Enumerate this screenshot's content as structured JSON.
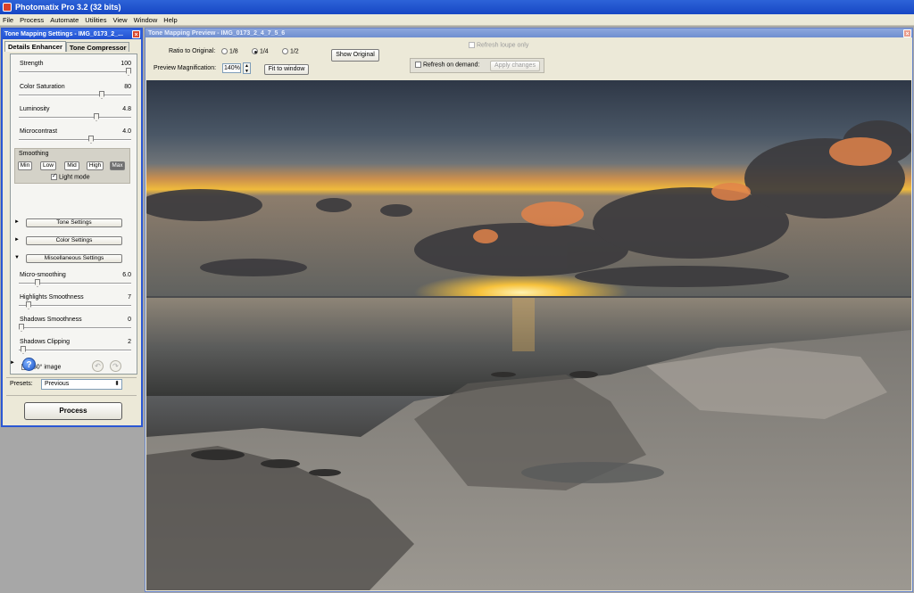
{
  "app": {
    "title": "Photomatix Pro 3.2 (32 bits)"
  },
  "menu": [
    "File",
    "Process",
    "Automate",
    "Utilities",
    "View",
    "Window",
    "Help"
  ],
  "settings_panel": {
    "title": "Tone Mapping Settings - IMG_0173_2_...",
    "close": "×",
    "tabs": [
      "Details Enhancer",
      "Tone Compressor"
    ],
    "active_tab": "Details Enhancer",
    "sliders": [
      {
        "label": "Strength",
        "value": "100",
        "position": 1.0
      },
      {
        "label": "Color Saturation",
        "value": "80",
        "position": 0.75
      },
      {
        "label": "Luminosity",
        "value": "4.8",
        "position": 0.7
      },
      {
        "label": "Microcontrast",
        "value": "4.0",
        "position": 0.65
      }
    ],
    "smoothing": {
      "title": "Smoothing",
      "buttons": [
        "Min",
        "Low",
        "Mid",
        "High",
        "Max"
      ],
      "selected": "Max",
      "light_mode_label": "Light mode",
      "light_mode_checked": true
    },
    "sections": [
      {
        "label": "Tone Settings",
        "expanded": false,
        "arrow": "►"
      },
      {
        "label": "Color Settings",
        "expanded": false,
        "arrow": "►"
      },
      {
        "label": "Miscellaneous Settings",
        "expanded": true,
        "arrow": "▼"
      }
    ],
    "misc_sliders": [
      {
        "label": "Micro-smoothing",
        "value": "6.0",
        "position": 0.15
      },
      {
        "label": "Highlights Smoothness",
        "value": "7",
        "position": 0.07
      },
      {
        "label": "Shadows Smoothness",
        "value": "0",
        "position": 0.0
      },
      {
        "label": "Shadows Clipping",
        "value": "2",
        "position": 0.02
      }
    ],
    "image_360_label": "360° image",
    "image_360_checked": false,
    "help_icon": "?",
    "undo_icon": "↶",
    "redo_icon": "↷",
    "expand_arrow": "►",
    "presets_label": "Presets:",
    "presets_value": "Previous",
    "select_caret": "⬍",
    "process_label": "Process"
  },
  "preview": {
    "title": "Tone Mapping Preview - IMG_0173_2_4_7_5_6",
    "close": "×",
    "ratio_label": "Ratio to Original:",
    "ratios": [
      "1/8",
      "1/4",
      "1/2"
    ],
    "ratio_selected": "1/4",
    "show_original_label": "Show Original",
    "magnification_label": "Preview Magnification:",
    "magnification_value": "140%",
    "spinner_up": "▲",
    "spinner_down": "▼",
    "fit_window_label": "Fit to window",
    "refresh_loupe_label": "Refresh loupe only",
    "refresh_demand_label": "Refresh on demand:",
    "apply_changes_label": "Apply changes"
  }
}
